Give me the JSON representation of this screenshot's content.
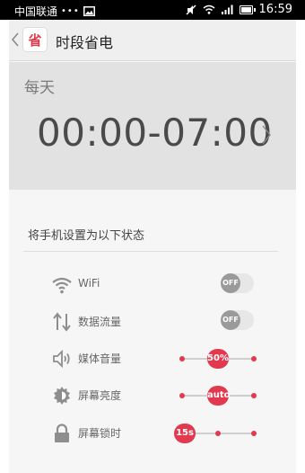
{
  "status_bar": {
    "carrier": "中国联通",
    "dots": "•••",
    "time": "16:59"
  },
  "app": {
    "icon_char": "省",
    "title": "时段省电"
  },
  "schedule": {
    "repeat": "每天",
    "time_range": "00:00-07:00"
  },
  "section": {
    "label": "将手机设置为以下状态"
  },
  "settings": [
    {
      "label": "WiFi",
      "icon": "wifi-icon",
      "control": "toggle",
      "value": "OFF"
    },
    {
      "label": "数据流量",
      "icon": "data-arrows-icon",
      "control": "toggle",
      "value": "OFF"
    },
    {
      "label": "媒体音量",
      "icon": "speaker-icon",
      "control": "slider",
      "value": "50%",
      "position": 0.5
    },
    {
      "label": "屏幕亮度",
      "icon": "brightness-icon",
      "control": "slider",
      "value": "auto",
      "position": 0.5
    },
    {
      "label": "屏幕锁时",
      "icon": "lock-icon",
      "control": "slider",
      "value": "15s",
      "position": 0.0
    }
  ],
  "colors": {
    "accent": "#e2394f",
    "toggle_off": "#9a9a9a",
    "header_bg": "#e2e2e2"
  }
}
